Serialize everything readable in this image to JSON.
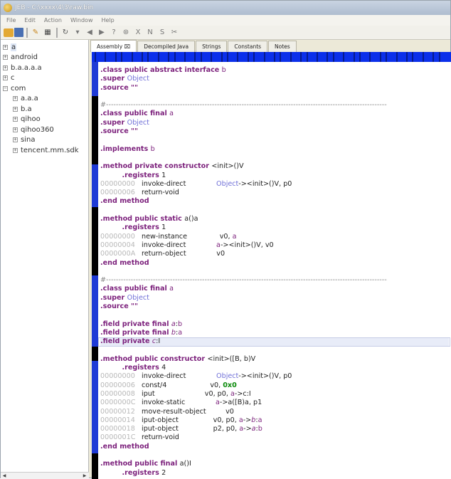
{
  "window": {
    "title": "JEB - C:\\xxxx\\4\\3\\raw.bin"
  },
  "menu": [
    "File",
    "Edit",
    "Action",
    "Window",
    "Help"
  ],
  "tree": {
    "nodes": [
      {
        "label": "a",
        "depth": 0,
        "expanded": false,
        "selected": true
      },
      {
        "label": "android",
        "depth": 0,
        "expanded": false
      },
      {
        "label": "b.a.a.a.a",
        "depth": 0,
        "expanded": false
      },
      {
        "label": "c",
        "depth": 0,
        "expanded": false
      },
      {
        "label": "com",
        "depth": 0,
        "expanded": true
      },
      {
        "label": "a.a.a",
        "depth": 1,
        "expanded": false
      },
      {
        "label": "b.a",
        "depth": 1,
        "expanded": false
      },
      {
        "label": "qihoo",
        "depth": 1,
        "expanded": false
      },
      {
        "label": "qihoo360",
        "depth": 1,
        "expanded": false
      },
      {
        "label": "sina",
        "depth": 1,
        "expanded": false
      },
      {
        "label": "tencent.mm.sdk",
        "depth": 1,
        "expanded": false
      }
    ]
  },
  "tabs": [
    {
      "label": "Assembly ⌧",
      "active": true
    },
    {
      "label": "Decompiled Java",
      "active": false
    },
    {
      "label": "Strings",
      "active": false
    },
    {
      "label": "Constants",
      "active": false
    },
    {
      "label": "Notes",
      "active": false
    }
  ],
  "code": [
    [
      [
        "kw",
        ".class public abstract interface "
      ],
      [
        "ty2",
        "b"
      ]
    ],
    [
      [
        "kw",
        ".super "
      ],
      [
        "ty",
        "Object"
      ]
    ],
    [
      [
        "kw",
        ".source "
      ],
      [
        "kw",
        "\"\""
      ]
    ],
    [],
    [
      [
        "cmt",
        "#------------------------------------------------------------------------------------------------------------------"
      ]
    ],
    [
      [
        "kw",
        ".class public final "
      ],
      [
        "ty2",
        "a"
      ]
    ],
    [
      [
        "kw",
        ".super "
      ],
      [
        "ty",
        "Object"
      ]
    ],
    [
      [
        "kw",
        ".source "
      ],
      [
        "kw",
        "\"\""
      ]
    ],
    [],
    [
      [
        "kw",
        ".implements "
      ],
      [
        "ty2",
        "b"
      ]
    ],
    [],
    [
      [
        "kw",
        ".method private constructor "
      ],
      [
        "op",
        "<init>()V"
      ]
    ],
    [
      [
        "pad",
        "          "
      ],
      [
        "kw",
        ".registers "
      ],
      [
        "op",
        "1"
      ]
    ],
    [
      [
        "adr",
        "00000000"
      ],
      [
        "op",
        " invoke-direct              "
      ],
      [
        "ty",
        "Object"
      ],
      [
        "op",
        "-><init>()V, p0"
      ]
    ],
    [
      [
        "adr",
        "00000006"
      ],
      [
        "op",
        " return-void"
      ]
    ],
    [
      [
        "kw",
        ".end method"
      ]
    ],
    [],
    [
      [
        "kw",
        ".method public static "
      ],
      [
        "op",
        "a()a"
      ]
    ],
    [
      [
        "pad",
        "          "
      ],
      [
        "kw",
        ".registers "
      ],
      [
        "op",
        "1"
      ]
    ],
    [
      [
        "adr",
        "00000000"
      ],
      [
        "op",
        " new-instance               v0, "
      ],
      [
        "ty2",
        "a"
      ]
    ],
    [
      [
        "adr",
        "00000004"
      ],
      [
        "op",
        " invoke-direct              "
      ],
      [
        "ty2",
        "a"
      ],
      [
        "op",
        "-><init>()V, v0"
      ]
    ],
    [
      [
        "adr",
        "0000000A"
      ],
      [
        "op",
        " return-object              v0"
      ]
    ],
    [
      [
        "kw",
        ".end method"
      ]
    ],
    [],
    [
      [
        "cmt",
        "#------------------------------------------------------------------------------------------------------------------"
      ]
    ],
    [
      [
        "kw",
        ".class public final "
      ],
      [
        "ty2",
        "a"
      ]
    ],
    [
      [
        "kw",
        ".super "
      ],
      [
        "ty",
        "Object"
      ]
    ],
    [
      [
        "kw",
        ".source "
      ],
      [
        "kw",
        "\"\""
      ]
    ],
    [],
    [
      [
        "kw",
        ".field private final "
      ],
      [
        "it",
        "a"
      ],
      [
        "op",
        ":"
      ],
      [
        "ty2",
        "b"
      ]
    ],
    [
      [
        "kw",
        ".field private final "
      ],
      [
        "it",
        "b"
      ],
      [
        "op",
        ":"
      ],
      [
        "ty2",
        "a"
      ]
    ],
    [
      [
        "kw",
        ".field private "
      ],
      [
        "it",
        "c"
      ],
      [
        "op",
        ":I"
      ]
    ],
    [],
    [
      [
        "kw",
        ".method public constructor "
      ],
      [
        "op",
        "<init>([B, b)V"
      ]
    ],
    [
      [
        "pad",
        "          "
      ],
      [
        "kw",
        ".registers "
      ],
      [
        "op",
        "4"
      ]
    ],
    [
      [
        "adr",
        "00000000"
      ],
      [
        "op",
        " invoke-direct              "
      ],
      [
        "ty",
        "Object"
      ],
      [
        "op",
        "-><init>()V, p0"
      ]
    ],
    [
      [
        "adr",
        "00000006"
      ],
      [
        "op",
        " const/4                    v0, "
      ],
      [
        "hx",
        "0x0"
      ]
    ],
    [
      [
        "adr",
        "00000008"
      ],
      [
        "op",
        " iput                       v0, p0, "
      ],
      [
        "ty2",
        "a"
      ],
      [
        "op",
        "->c:I"
      ]
    ],
    [
      [
        "adr",
        "0000000C"
      ],
      [
        "op",
        " invoke-static              "
      ],
      [
        "ty2",
        "a"
      ],
      [
        "op",
        "->a([B)a, p1"
      ]
    ],
    [
      [
        "adr",
        "00000012"
      ],
      [
        "op",
        " move-result-object         v0"
      ]
    ],
    [
      [
        "adr",
        "00000014"
      ],
      [
        "op",
        " iput-object                v0, p0, "
      ],
      [
        "ty2",
        "a"
      ],
      [
        "op",
        "->"
      ],
      [
        "it",
        "b"
      ],
      [
        "op",
        ":"
      ],
      [
        "ty2",
        "a"
      ]
    ],
    [
      [
        "adr",
        "00000018"
      ],
      [
        "op",
        " iput-object                p2, p0, "
      ],
      [
        "ty2",
        "a"
      ],
      [
        "op",
        "->"
      ],
      [
        "it",
        "a"
      ],
      [
        "op",
        ":"
      ],
      [
        "ty2",
        "b"
      ]
    ],
    [
      [
        "adr",
        "0000001C"
      ],
      [
        "op",
        " return-void"
      ]
    ],
    [
      [
        "kw",
        ".end method"
      ]
    ],
    [],
    [
      [
        "kw",
        ".method public final "
      ],
      [
        "op",
        "a()I"
      ]
    ],
    [
      [
        "pad",
        "          "
      ],
      [
        "kw",
        ".registers "
      ],
      [
        "op",
        "2"
      ]
    ]
  ],
  "highlight_line": 31
}
